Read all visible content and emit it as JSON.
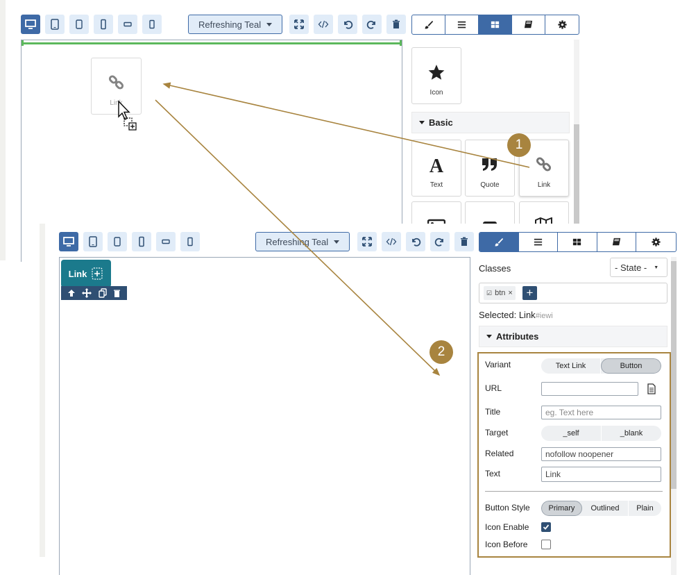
{
  "colors": {
    "accent": "#3e6aa6",
    "annotation": "#a8843f",
    "teal": "#1b7a8c",
    "drop_line": "#5cb85c"
  },
  "toolbar": {
    "device_buttons": [
      "desktop-icon",
      "tablet-icon",
      "tablet-small-icon",
      "mobile-icon",
      "mobile-landscape-icon",
      "mobile-small-icon"
    ],
    "theme": "Refreshing Teal",
    "actions": [
      "fullscreen-icon",
      "code-icon",
      "undo-icon",
      "redo-icon",
      "trash-icon"
    ],
    "tabs": [
      "brush-icon",
      "layers-icon",
      "blocks-icon",
      "book-icon",
      "gear-icon"
    ]
  },
  "step1": {
    "dragged_label": "Link",
    "blocks_top": [
      {
        "label": "Icon",
        "icon": "star-icon"
      }
    ],
    "section": "Basic",
    "blocks": [
      {
        "label": "Text",
        "icon": "text-a-icon"
      },
      {
        "label": "Quote",
        "icon": "quote-icon"
      },
      {
        "label": "Link",
        "icon": "link-icon"
      }
    ],
    "badge": "1"
  },
  "step2": {
    "badge": "2",
    "component_label": "Link",
    "classes_label": "Classes",
    "state_select": "- State -",
    "class_tags": [
      "btn"
    ],
    "selected_label": "Selected:",
    "selected_name": "Link",
    "selected_id": "#iewi",
    "attributes_title": "Attributes",
    "variant": {
      "label": "Variant",
      "options": [
        "Text Link",
        "Button"
      ],
      "selected": "Button"
    },
    "url": {
      "label": "URL",
      "value": ""
    },
    "title_field": {
      "label": "Title",
      "placeholder": "eg. Text here"
    },
    "target": {
      "label": "Target",
      "options": [
        "_self",
        "_blank"
      ]
    },
    "related": {
      "label": "Related",
      "value": "nofollow noopener"
    },
    "text_field": {
      "label": "Text",
      "value": "Link"
    },
    "button_style": {
      "label": "Button Style",
      "options": [
        "Primary",
        "Outlined",
        "Plain"
      ],
      "selected": "Primary"
    },
    "icon_enable": {
      "label": "Icon Enable",
      "checked": true
    },
    "icon_before": {
      "label": "Icon Before",
      "checked": false
    }
  }
}
